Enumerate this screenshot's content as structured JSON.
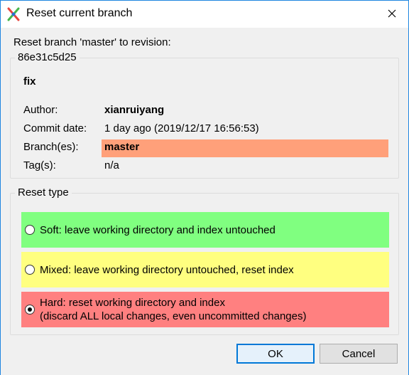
{
  "window": {
    "title": "Reset current branch",
    "icon": "git-extensions-icon",
    "close_icon": "close-icon"
  },
  "heading": "Reset branch 'master' to revision:",
  "commit": {
    "hash": "86e31c5d25",
    "message": "fix",
    "author_label": "Author:",
    "author": "xianruiyang",
    "date_label": "Commit date:",
    "date": "1 day ago (2019/12/17 16:56:53)",
    "branch_label": "Branch(es):",
    "branch": "master",
    "branch_color": "#ffa07a",
    "tag_label": "Tag(s):",
    "tag": "n/a"
  },
  "reset_type": {
    "legend": "Reset type",
    "options": [
      {
        "line1": "Soft: leave working directory and index untouched",
        "line2": "",
        "color": "#80ff80",
        "selected": false
      },
      {
        "line1": "Mixed: leave working directory untouched, reset index",
        "line2": "",
        "color": "#ffff80",
        "selected": false
      },
      {
        "line1": "Hard: reset working directory and index",
        "line2": "(discard ALL local changes, even uncommitted changes)",
        "color": "#ff8080",
        "selected": true
      }
    ]
  },
  "buttons": {
    "ok": "OK",
    "cancel": "Cancel"
  }
}
